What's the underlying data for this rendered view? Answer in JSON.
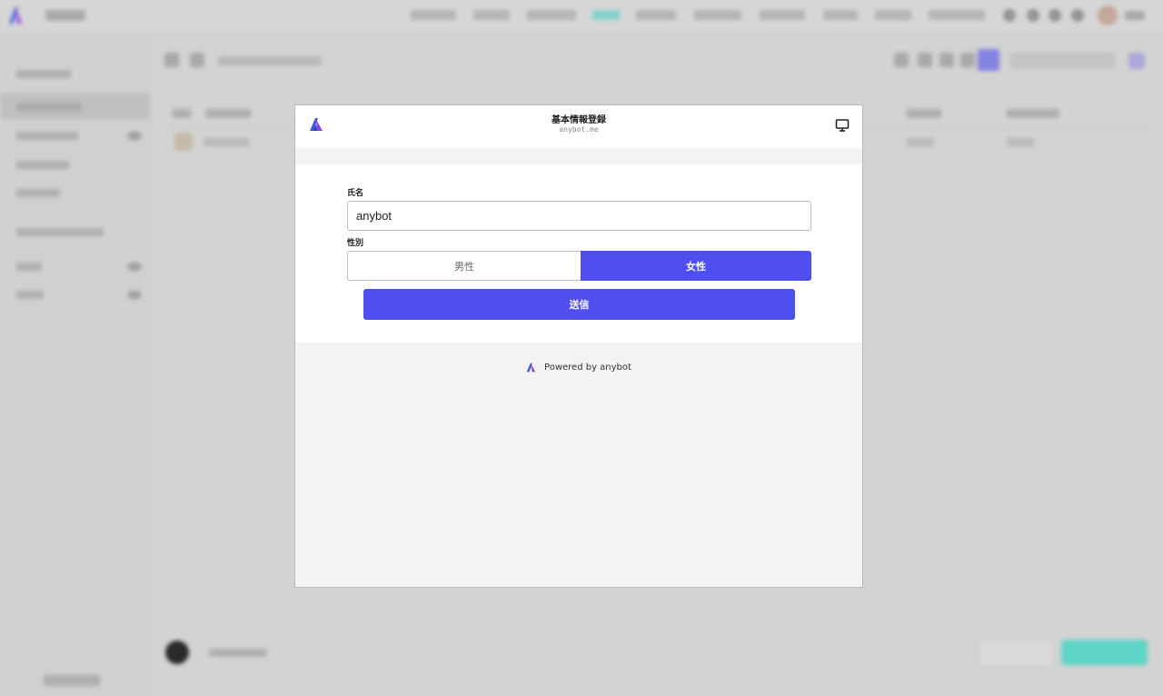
{
  "modal": {
    "title": "基本情報登録",
    "subtitle": "anybot.me",
    "form": {
      "name_label": "氏名",
      "name_value": "anybot",
      "gender_label": "性別",
      "gender_options": [
        "男性",
        "女性"
      ],
      "selected_gender": "女性",
      "submit_label": "送信"
    },
    "footer": {
      "powered_by": "Powered by anybot"
    }
  },
  "colors": {
    "accent": "#4f4ff0",
    "logo_blue": "#3a5bd9",
    "logo_purple": "#8b3fe0",
    "background_teal": "#5fd4c6"
  },
  "icons": {
    "modal_logo": "anybot-logo-icon",
    "device": "monitor-icon"
  }
}
